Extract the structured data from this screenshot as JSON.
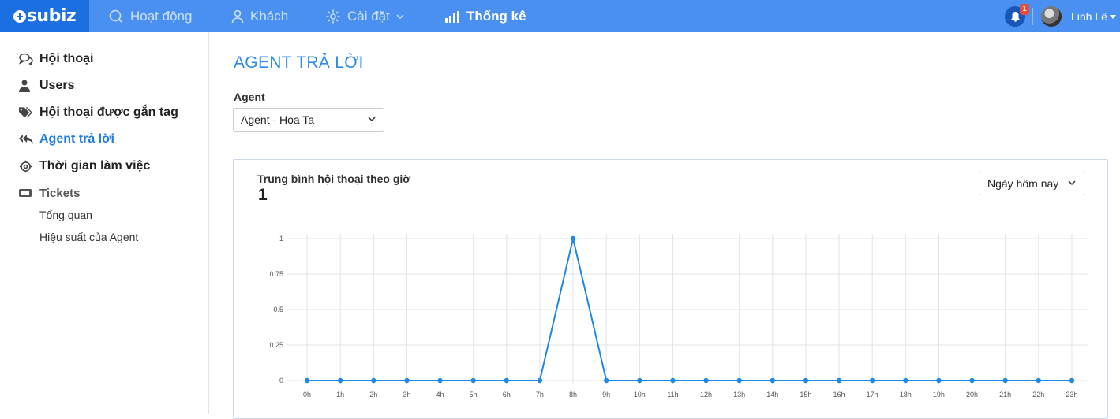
{
  "app": {
    "logo_text": "subiz"
  },
  "nav": {
    "activity": "Hoạt động",
    "customers": "Khách",
    "settings": "Cài đặt",
    "stats": "Thống kê",
    "notification_count": "1",
    "user_name": "Linh Lê"
  },
  "sidebar": {
    "items": [
      {
        "label": "Hội thoại",
        "icon": "chat-bubbles-icon"
      },
      {
        "label": "Users",
        "icon": "user-icon"
      },
      {
        "label": "Hội thoại được gắn tag",
        "icon": "tags-icon"
      },
      {
        "label": "Agent trả lời",
        "icon": "reply-all-icon"
      },
      {
        "label": "Thời gian làm việc",
        "icon": "gear-icon"
      },
      {
        "label": "Tickets",
        "icon": "ticket-icon"
      }
    ],
    "sub_items": [
      "Tổng quan",
      "Hiệu suất của Agent"
    ]
  },
  "main": {
    "title": "AGENT TRẢ LỜI",
    "agent_label": "Agent",
    "agent_selected": "Agent - Hoa Ta",
    "chart_card": {
      "title": "Trung bình hội thoại theo giờ",
      "value": "1",
      "range_selected": "Ngày hôm nay"
    }
  },
  "colors": {
    "topbar": "#4a90f0",
    "logo_bg": "#1b6fe0",
    "accent": "#2d8ce8",
    "line": "#1e88e5"
  },
  "chart_data": {
    "type": "line",
    "title": "Trung bình hội thoại theo giờ",
    "x": [
      "0h",
      "1h",
      "2h",
      "3h",
      "4h",
      "5h",
      "6h",
      "7h",
      "8h",
      "9h",
      "10h",
      "11h",
      "12h",
      "13h",
      "14h",
      "15h",
      "16h",
      "17h",
      "18h",
      "19h",
      "20h",
      "21h",
      "22h",
      "23h"
    ],
    "series": [
      {
        "values": [
          0,
          0,
          0,
          0,
          0,
          0,
          0,
          0,
          1,
          0,
          0,
          0,
          0,
          0,
          0,
          0,
          0,
          0,
          0,
          0,
          0,
          0,
          0,
          0
        ]
      }
    ],
    "yticks": [
      "0",
      "0.25",
      "0.5",
      "0.75",
      "1"
    ],
    "ylim": [
      0,
      1
    ],
    "grid": true,
    "legend": "none"
  }
}
